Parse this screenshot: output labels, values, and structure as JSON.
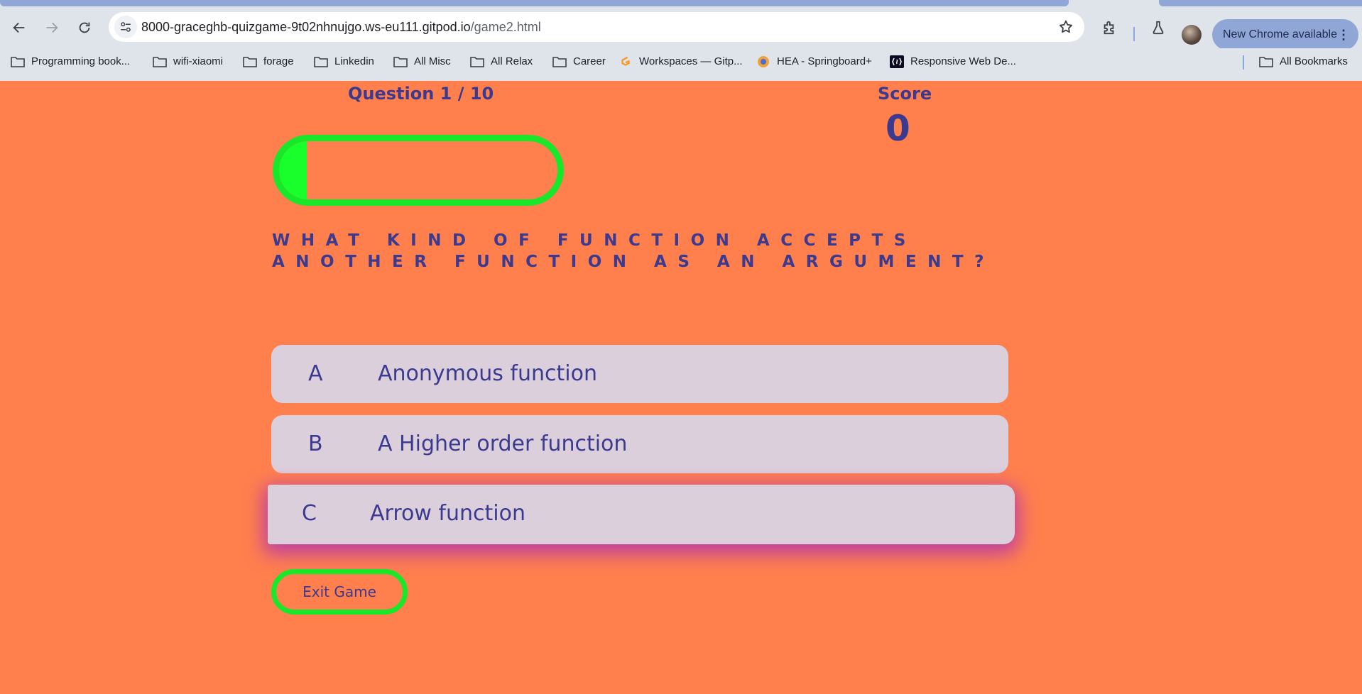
{
  "browser": {
    "url_host": "8000-graceghb-quizgame-9t02nhnujgo.ws-eu111.gitpod.io",
    "url_path": "/game2.html",
    "update_button": "New Chrome available",
    "bookmarks": [
      {
        "label": "Programming book...",
        "icon": "folder-icon"
      },
      {
        "label": "wifi-xiaomi",
        "icon": "folder-icon"
      },
      {
        "label": "forage",
        "icon": "folder-icon"
      },
      {
        "label": "Linkedin",
        "icon": "folder-icon"
      },
      {
        "label": "All Misc",
        "icon": "folder-icon"
      },
      {
        "label": "All Relax",
        "icon": "folder-icon"
      },
      {
        "label": "Career",
        "icon": "folder-icon"
      },
      {
        "label": "Workspaces — Gitp...",
        "icon": "gitpod-icon"
      },
      {
        "label": "HEA - Springboard+",
        "icon": "springboard-icon"
      },
      {
        "label": "Responsive Web De...",
        "icon": "freecodecamp-icon"
      }
    ],
    "all_bookmarks": "All Bookmarks"
  },
  "game": {
    "question_counter": "Question 1 / 10",
    "score_label": "Score",
    "score_value": "0",
    "progress_fraction": 0.1,
    "question": "What kind of function accepts another function as an argument?",
    "choices": [
      {
        "prefix": "A",
        "text": "Anonymous function"
      },
      {
        "prefix": "B",
        "text": "A Higher order function"
      },
      {
        "prefix": "C",
        "text": "Arrow function"
      }
    ],
    "exit_label": "Exit Game"
  },
  "colors": {
    "page_background": "#ff7f4d",
    "accent_green": "#19e82a",
    "text_indigo": "#3b3a8f",
    "choice_background": "#dccfdc",
    "hover_glow": "#c040a0"
  }
}
